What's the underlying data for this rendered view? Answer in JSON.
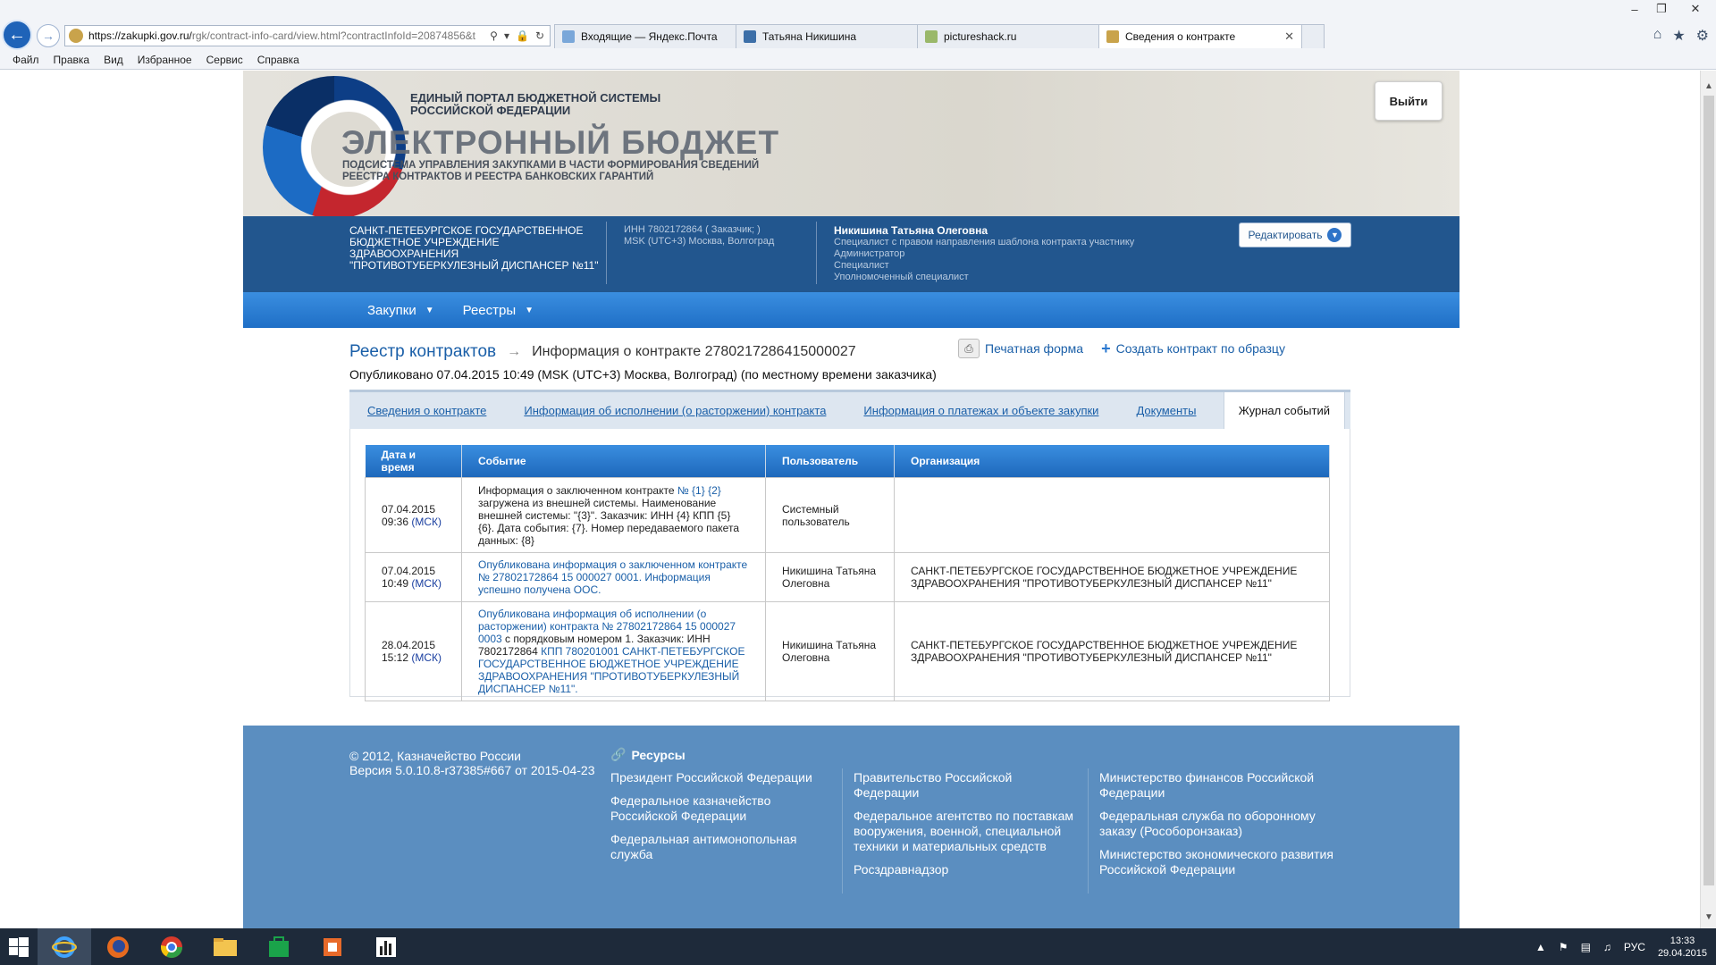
{
  "browser": {
    "url_main": "https://zakupki.gov.ru/",
    "url_rest": "rgk/contract-info-card/view.html?contractInfoId=20874856&t",
    "tabs": [
      {
        "label": "Входящие — Яндекс.Почта",
        "active": false
      },
      {
        "label": "Татьяна Никишина",
        "active": false
      },
      {
        "label": "pictureshack.ru",
        "active": false
      },
      {
        "label": "Сведения о контракте",
        "active": true
      }
    ],
    "menu": [
      "Файл",
      "Правка",
      "Вид",
      "Избранное",
      "Сервис",
      "Справка"
    ]
  },
  "header": {
    "title1": "ЕДИНЫЙ ПОРТАЛ БЮДЖЕТНОЙ СИСТЕМЫ РОССИЙСКОЙ ФЕДЕРАЦИИ",
    "title2": "ЭЛЕКТРОННЫЙ БЮДЖЕТ",
    "title3": "ПОДСИСТЕМА УПРАВЛЕНИЯ ЗАКУПКАМИ В ЧАСТИ ФОРМИРОВАНИЯ СВЕДЕНИЙ РЕЕСТРА КОНТРАКТОВ И РЕЕСТРА БАНКОВСКИХ ГАРАНТИЙ",
    "logout": "Выйти"
  },
  "userbar": {
    "org": "САНКТ-ПЕТЕБУРГСКОЕ ГОСУДАРСТВЕННОЕ БЮДЖЕТНОЕ УЧРЕЖДЕНИЕ ЗДРАВООХРАНЕНИЯ \"ПРОТИВОТУБЕРКУЛЕЗНЫЙ ДИСПАНСЕР №11\"",
    "inn": "ИНН 7802172864 ( Заказчик; )",
    "tz": "MSK (UTC+3) Москва, Волгоград",
    "user": "Никишина Татьяна Олеговна",
    "roles": [
      "Специалист с правом направления шаблона контракта участнику",
      "Администратор",
      "Специалист",
      "Уполномоченный специалист"
    ],
    "edit": "Редактировать"
  },
  "nav": [
    "Закупки",
    "Реестры"
  ],
  "crumb": {
    "root": "Реестр контрактов",
    "current": "Информация о контракте 2780217286415000027"
  },
  "published": "Опубликовано 07.04.2015 10:49 (MSK (UTC+3) Москва, Волгоград) (по местному времени заказчика)",
  "actions": {
    "print": "Печатная форма",
    "create": "Создать контракт по образцу"
  },
  "tabs": [
    "Сведения о контракте",
    "Информация об исполнении (о расторжении) контракта",
    "Информация о платежах и объекте закупки",
    "Документы",
    "Журнал событий"
  ],
  "table": {
    "headers": [
      "Дата и время",
      "Событие",
      "Пользователь",
      "Организация"
    ],
    "rows": [
      {
        "date": "07.04.2015",
        "time": "09:36",
        "tz": "(МСК)",
        "event_pre": "Информация о заключенном контракте ",
        "event_link": "№ {1} {2}",
        "event_post": " загружена из внешней системы. Наименование внешней системы: \"{3}\". Заказчик: ИНН {4} КПП {5} {6}. Дата события: {7}. Номер передаваемого пакета данных: {8}",
        "user": "Системный пользователь",
        "org": ""
      },
      {
        "date": "07.04.2015",
        "time": "10:49",
        "tz": "(МСК)",
        "event_pre": "",
        "event_link": "Опубликована информация о заключенном контракте № 27802172864 15 000027 0001. Информация успешно получена ООС.",
        "event_post": "",
        "user": "Никишина Татьяна Олеговна",
        "org": "САНКТ-ПЕТЕБУРГСКОЕ ГОСУДАРСТВЕННОЕ БЮДЖЕТНОЕ УЧРЕЖДЕНИЕ ЗДРАВООХРАНЕНИЯ \"ПРОТИВОТУБЕРКУЛЕЗНЫЙ ДИСПАНСЕР №11\""
      },
      {
        "date": "28.04.2015",
        "time": "15:12",
        "tz": "(МСК)",
        "event_pre": "",
        "event_link": "Опубликована информация об исполнении (о расторжении) контракта № 27802172864 15 000027 0003",
        "event_post": " с порядковым номером 1. Заказчик: ИНН 7802172864 ",
        "event_link2": "КПП 780201001 САНКТ-ПЕТЕБУРГСКОЕ ГОСУДАРСТВЕННОЕ БЮДЖЕТНОЕ УЧРЕЖДЕНИЕ ЗДРАВООХРАНЕНИЯ \"ПРОТИВОТУБЕРКУЛЕЗНЫЙ ДИСПАНСЕР №11\".",
        "user": "Никишина Татьяна Олеговна",
        "org": "САНКТ-ПЕТЕБУРГСКОЕ ГОСУДАРСТВЕННОЕ БЮДЖЕТНОЕ УЧРЕЖДЕНИЕ ЗДРАВООХРАНЕНИЯ \"ПРОТИВОТУБЕРКУЛЕЗНЫЙ ДИСПАНСЕР №11\""
      }
    ]
  },
  "footer": {
    "copy1": "© 2012, Казначейство России",
    "copy2": "Версия 5.0.10.8-r37385#667 от 2015-04-23",
    "resources": "Ресурсы",
    "col1": [
      "Президент Российской Федерации",
      "Федеральное казначейство Российской Федерации",
      "Федеральная антимонопольная служба"
    ],
    "col2": [
      "Правительство Российской Федерации",
      "Федеральное агентство по поставкам вооружения, военной, специальной техники и материальных средств",
      "Росздравнадзор"
    ],
    "col3": [
      "Министерство финансов Российской Федерации",
      "Федеральная служба по оборонному заказу (Рособоронзаказ)",
      "Министерство экономического развития Российской Федерации"
    ]
  },
  "tray": {
    "lang": "РУС",
    "time": "13:33",
    "date": "29.04.2015"
  }
}
